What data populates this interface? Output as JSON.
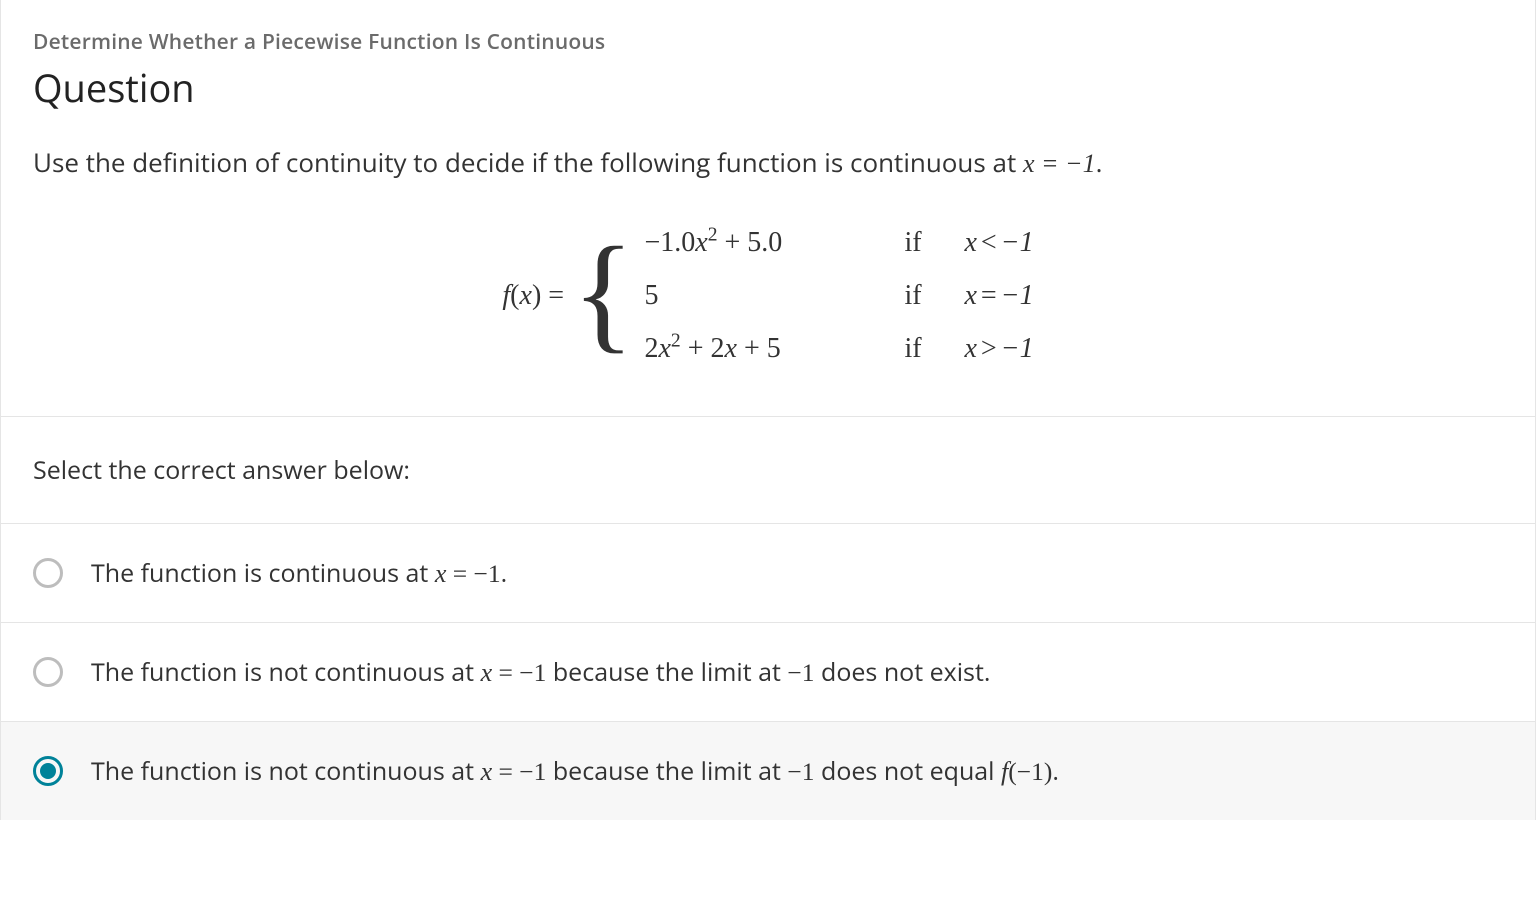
{
  "topic": "Determine Whether a Piecewise Function Is Continuous",
  "title": "Question",
  "prompt": {
    "prefix": "Use the definition of continuity to decide if the following function is continuous at ",
    "math": "x = −1",
    "suffix": "."
  },
  "piecewise": {
    "lhs": "f(x) =",
    "pieces": [
      {
        "expr": "−1.0x² + 5.0",
        "if": "if",
        "cond_lhs": "x",
        "cond_op": "<",
        "cond_rhs": "−1"
      },
      {
        "expr": "5",
        "if": "if",
        "cond_lhs": "x",
        "cond_op": "=",
        "cond_rhs": "−1"
      },
      {
        "expr": "2x² + 2x + 5",
        "if": "if",
        "cond_lhs": "x",
        "cond_op": ">",
        "cond_rhs": "−1"
      }
    ]
  },
  "select_label": "Select the correct answer below:",
  "options": [
    {
      "selected": false,
      "parts": [
        {
          "t": "The function is continuous at ",
          "m": false
        },
        {
          "t": "x = −1",
          "m": true
        },
        {
          "t": ".",
          "m": false
        }
      ]
    },
    {
      "selected": false,
      "parts": [
        {
          "t": "The function is not continuous at ",
          "m": false
        },
        {
          "t": "x = −1",
          "m": true
        },
        {
          "t": " because the limit at ",
          "m": false
        },
        {
          "t": "−1",
          "m": true
        },
        {
          "t": " does not exist.",
          "m": false
        }
      ]
    },
    {
      "selected": true,
      "parts": [
        {
          "t": "The function is not continuous at ",
          "m": false
        },
        {
          "t": "x = −1",
          "m": true
        },
        {
          "t": " because the limit at ",
          "m": false
        },
        {
          "t": "−1",
          "m": true
        },
        {
          "t": " does not equal ",
          "m": false
        },
        {
          "t": "f(−1)",
          "m": true
        },
        {
          "t": ".",
          "m": false
        }
      ]
    }
  ]
}
